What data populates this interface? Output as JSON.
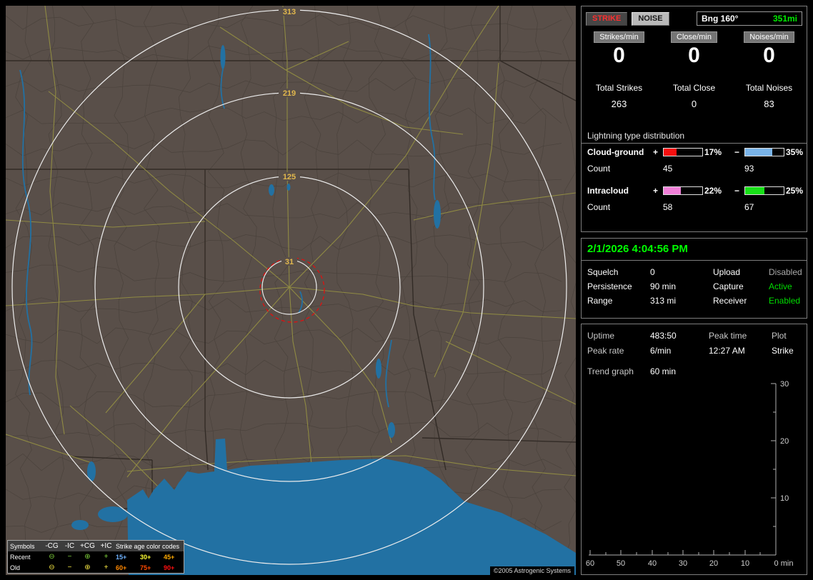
{
  "map": {
    "ring_labels": [
      "313",
      "219",
      "125",
      "31"
    ],
    "copyright": "©2005 Astrogenic Systems",
    "legend": {
      "header": {
        "symbols": "Symbols",
        "cols": [
          "-CG",
          "-IC",
          "+CG",
          "+IC"
        ],
        "age": "Strike age color codes"
      },
      "rows": [
        {
          "label": "Recent",
          "symbols": [
            "⊖",
            "−",
            "⊕",
            "+"
          ],
          "symbol_color": "#7fd13b",
          "ages": [
            {
              "t": "15+",
              "c": "#6fb3ff"
            },
            {
              "t": "30+",
              "c": "#ffff33"
            },
            {
              "t": "45+",
              "c": "#ffaa00"
            }
          ]
        },
        {
          "label": "Old",
          "symbols": [
            "⊖",
            "−",
            "⊕",
            "+"
          ],
          "symbol_color": "#f5e642",
          "ages": [
            {
              "t": "60+",
              "c": "#ff8800"
            },
            {
              "t": "75+",
              "c": "#ff4a00"
            },
            {
              "t": "90+",
              "c": "#ff0f0f"
            }
          ]
        }
      ]
    }
  },
  "toolbar": {
    "strike": "STRIKE",
    "noise": "NOISE",
    "bearing_label": "Bng 160°",
    "bearing_value": "351mi"
  },
  "counters": [
    {
      "label": "Strikes/min",
      "value": "0",
      "total_label": "Total Strikes",
      "total": "263"
    },
    {
      "label": "Close/min",
      "value": "0",
      "total_label": "Total Close",
      "total": "0"
    },
    {
      "label": "Noises/min",
      "value": "0",
      "total_label": "Total Noises",
      "total": "83"
    }
  ],
  "distribution": {
    "title": "Lightning type distribution",
    "count_label": "Count",
    "plus": "+",
    "minus": "−",
    "rows": [
      {
        "label": "Cloud-ground",
        "plus_pct": 17,
        "plus_pct_text": "17%",
        "plus_color": "#f50f0f",
        "plus_count": "45",
        "minus_pct": 35,
        "minus_pct_text": "35%",
        "minus_color": "#7ab4e8",
        "minus_count": "93"
      },
      {
        "label": "Intracloud",
        "plus_pct": 22,
        "plus_pct_text": "22%",
        "plus_color": "#f07fd8",
        "plus_count": "58",
        "minus_pct": 25,
        "minus_pct_text": "25%",
        "minus_color": "#18e018",
        "minus_count": "67"
      }
    ]
  },
  "status": {
    "datetime": "2/1/2026 4:04:56 PM",
    "rows": [
      {
        "l1": "Squelch",
        "v1": "0",
        "l2": "Upload",
        "v2": "Disabled",
        "v2_color": "#a8a8a8"
      },
      {
        "l1": "Persistence",
        "v1": "90 min",
        "l2": "Capture",
        "v2": "Active",
        "v2_color": "#00dd00"
      },
      {
        "l1": "Range",
        "v1": "313 mi",
        "l2": "Receiver",
        "v2": "Enabled",
        "v2_color": "#00dd00"
      }
    ]
  },
  "stats": {
    "uptime_label": "Uptime",
    "uptime": "483:50",
    "peaktime_label": "Peak time",
    "plot_label": "Plot",
    "peakrate_label": "Peak rate",
    "peakrate": "6/min",
    "peaktime": "12:27 AM",
    "plot": "Strike",
    "trend_label": "Trend graph",
    "trend_value": "60 min"
  },
  "trend": {
    "y_ticks": [
      "30",
      "20",
      "10"
    ],
    "x_ticks": [
      "60",
      "50",
      "40",
      "30",
      "20",
      "10"
    ],
    "origin": "0 min"
  }
}
